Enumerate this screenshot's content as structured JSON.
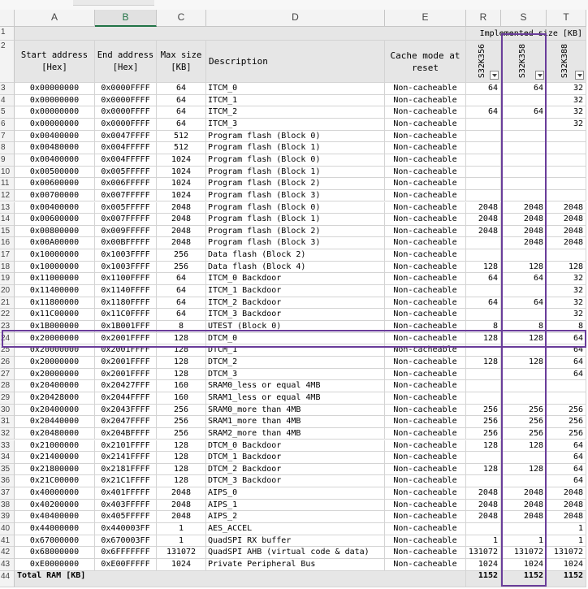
{
  "columns": [
    "A",
    "B",
    "C",
    "D",
    "E",
    "R",
    "S",
    "T"
  ],
  "selected_column": "B",
  "group_header": "Implemented size [KB]",
  "headers": {
    "start": "Start address [Hex]",
    "end": "End address [Hex]",
    "max": "Max size [KB]",
    "desc": "Description",
    "cache": "Cache mode at reset",
    "r": "S32K356",
    "s": "S32K358",
    "t": "S32K388"
  },
  "rows": [
    {
      "n": "3",
      "start": "0x00000000",
      "end": "0x0000FFFF",
      "max": "64",
      "desc": "ITCM_0",
      "cache": "Non-cacheable",
      "r": "64",
      "s": "64",
      "t": "32"
    },
    {
      "n": "4",
      "start": "0x00000000",
      "end": "0x0000FFFF",
      "max": "64",
      "desc": "ITCM_1",
      "cache": "Non-cacheable",
      "r": "",
      "s": "",
      "t": "32"
    },
    {
      "n": "5",
      "start": "0x00000000",
      "end": "0x0000FFFF",
      "max": "64",
      "desc": "ITCM_2",
      "cache": "Non-cacheable",
      "r": "64",
      "s": "64",
      "t": "32"
    },
    {
      "n": "6",
      "start": "0x00000000",
      "end": "0x0000FFFF",
      "max": "64",
      "desc": "ITCM_3",
      "cache": "Non-cacheable",
      "r": "",
      "s": "",
      "t": "32"
    },
    {
      "n": "7",
      "start": "0x00400000",
      "end": "0x0047FFFF",
      "max": "512",
      "desc": "Program flash (Block 0)",
      "cache": "Non-cacheable",
      "r": "",
      "s": "",
      "t": ""
    },
    {
      "n": "8",
      "start": "0x00480000",
      "end": "0x004FFFFF",
      "max": "512",
      "desc": "Program flash (Block 1)",
      "cache": "Non-cacheable",
      "r": "",
      "s": "",
      "t": ""
    },
    {
      "n": "9",
      "start": "0x00400000",
      "end": "0x004FFFFF",
      "max": "1024",
      "desc": "Program flash (Block 0)",
      "cache": "Non-cacheable",
      "r": "",
      "s": "",
      "t": ""
    },
    {
      "n": "10",
      "start": "0x00500000",
      "end": "0x005FFFFF",
      "max": "1024",
      "desc": "Program flash (Block 1)",
      "cache": "Non-cacheable",
      "r": "",
      "s": "",
      "t": ""
    },
    {
      "n": "11",
      "start": "0x00600000",
      "end": "0x006FFFFF",
      "max": "1024",
      "desc": "Program flash (Block 2)",
      "cache": "Non-cacheable",
      "r": "",
      "s": "",
      "t": ""
    },
    {
      "n": "12",
      "start": "0x00700000",
      "end": "0x007FFFFF",
      "max": "1024",
      "desc": "Program flash (Block 3)",
      "cache": "Non-cacheable",
      "r": "",
      "s": "",
      "t": ""
    },
    {
      "n": "13",
      "start": "0x00400000",
      "end": "0x005FFFFF",
      "max": "2048",
      "desc": "Program flash (Block 0)",
      "cache": "Non-cacheable",
      "r": "2048",
      "s": "2048",
      "t": "2048"
    },
    {
      "n": "14",
      "start": "0x00600000",
      "end": "0x007FFFFF",
      "max": "2048",
      "desc": "Program flash (Block 1)",
      "cache": "Non-cacheable",
      "r": "2048",
      "s": "2048",
      "t": "2048"
    },
    {
      "n": "15",
      "start": "0x00800000",
      "end": "0x009FFFFF",
      "max": "2048",
      "desc": "Program flash (Block 2)",
      "cache": "Non-cacheable",
      "r": "2048",
      "s": "2048",
      "t": "2048"
    },
    {
      "n": "16",
      "start": "0x00A00000",
      "end": "0x00BFFFFF",
      "max": "2048",
      "desc": "Program flash (Block 3)",
      "cache": "Non-cacheable",
      "r": "",
      "s": "2048",
      "t": "2048"
    },
    {
      "n": "17",
      "start": "0x10000000",
      "end": "0x1003FFFF",
      "max": "256",
      "desc": "Data flash (Block 2)",
      "cache": "Non-cacheable",
      "r": "",
      "s": "",
      "t": ""
    },
    {
      "n": "18",
      "start": "0x10000000",
      "end": "0x1003FFFF",
      "max": "256",
      "desc": "Data flash (Block 4)",
      "cache": "Non-cacheable",
      "r": "128",
      "s": "128",
      "t": "128"
    },
    {
      "n": "19",
      "start": "0x11000000",
      "end": "0x1100FFFF",
      "max": "64",
      "desc": "ITCM_0 Backdoor",
      "cache": "Non-cacheable",
      "r": "64",
      "s": "64",
      "t": "32"
    },
    {
      "n": "20",
      "start": "0x11400000",
      "end": "0x1140FFFF",
      "max": "64",
      "desc": "ITCM_1 Backdoor",
      "cache": "Non-cacheable",
      "r": "",
      "s": "",
      "t": "32"
    },
    {
      "n": "21",
      "start": "0x11800000",
      "end": "0x1180FFFF",
      "max": "64",
      "desc": "ITCM_2 Backdoor",
      "cache": "Non-cacheable",
      "r": "64",
      "s": "64",
      "t": "32"
    },
    {
      "n": "22",
      "start": "0x11C00000",
      "end": "0x11C0FFFF",
      "max": "64",
      "desc": "ITCM_3 Backdoor",
      "cache": "Non-cacheable",
      "r": "",
      "s": "",
      "t": "32"
    },
    {
      "n": "23",
      "start": "0x1B000000",
      "end": "0x1B001FFF",
      "max": "8",
      "desc": "UTEST (Block 0)",
      "cache": "Non-cacheable",
      "r": "8",
      "s": "8",
      "t": "8"
    },
    {
      "n": "24",
      "start": "0x20000000",
      "end": "0x2001FFFF",
      "max": "128",
      "desc": "DTCM_0",
      "cache": "Non-cacheable",
      "r": "128",
      "s": "128",
      "t": "64"
    },
    {
      "n": "25",
      "start": "0x20000000",
      "end": "0x2001FFFF",
      "max": "128",
      "desc": "DTCM_1",
      "cache": "Non-cacheable",
      "r": "",
      "s": "",
      "t": "64"
    },
    {
      "n": "26",
      "start": "0x20000000",
      "end": "0x2001FFFF",
      "max": "128",
      "desc": "DTCM_2",
      "cache": "Non-cacheable",
      "r": "128",
      "s": "128",
      "t": "64"
    },
    {
      "n": "27",
      "start": "0x20000000",
      "end": "0x2001FFFF",
      "max": "128",
      "desc": "DTCM_3",
      "cache": "Non-cacheable",
      "r": "",
      "s": "",
      "t": "64"
    },
    {
      "n": "28",
      "start": "0x20400000",
      "end": "0x20427FFF",
      "max": "160",
      "desc": "SRAM0_less or equal 4MB",
      "cache": "Non-cacheable",
      "r": "",
      "s": "",
      "t": ""
    },
    {
      "n": "29",
      "start": "0x20428000",
      "end": "0x2044FFFF",
      "max": "160",
      "desc": "SRAM1_less or equal 4MB",
      "cache": "Non-cacheable",
      "r": "",
      "s": "",
      "t": ""
    },
    {
      "n": "30",
      "start": "0x20400000",
      "end": "0x2043FFFF",
      "max": "256",
      "desc": "SRAM0_more than 4MB",
      "cache": "Non-cacheable",
      "r": "256",
      "s": "256",
      "t": "256"
    },
    {
      "n": "31",
      "start": "0x20440000",
      "end": "0x2047FFFF",
      "max": "256",
      "desc": "SRAM1_more than 4MB",
      "cache": "Non-cacheable",
      "r": "256",
      "s": "256",
      "t": "256"
    },
    {
      "n": "32",
      "start": "0x20480000",
      "end": "0x204BFFFF",
      "max": "256",
      "desc": "SRAM2_more than 4MB",
      "cache": "Non-cacheable",
      "r": "256",
      "s": "256",
      "t": "256"
    },
    {
      "n": "33",
      "start": "0x21000000",
      "end": "0x2101FFFF",
      "max": "128",
      "desc": "DTCM_0 Backdoor",
      "cache": "Non-cacheable",
      "r": "128",
      "s": "128",
      "t": "64"
    },
    {
      "n": "34",
      "start": "0x21400000",
      "end": "0x2141FFFF",
      "max": "128",
      "desc": "DTCM_1 Backdoor",
      "cache": "Non-cacheable",
      "r": "",
      "s": "",
      "t": "64"
    },
    {
      "n": "35",
      "start": "0x21800000",
      "end": "0x2181FFFF",
      "max": "128",
      "desc": "DTCM_2 Backdoor",
      "cache": "Non-cacheable",
      "r": "128",
      "s": "128",
      "t": "64"
    },
    {
      "n": "36",
      "start": "0x21C00000",
      "end": "0x21C1FFFF",
      "max": "128",
      "desc": "DTCM_3 Backdoor",
      "cache": "Non-cacheable",
      "r": "",
      "s": "",
      "t": "64"
    },
    {
      "n": "37",
      "start": "0x40000000",
      "end": "0x401FFFFF",
      "max": "2048",
      "desc": "AIPS_0",
      "cache": "Non-cacheable",
      "r": "2048",
      "s": "2048",
      "t": "2048"
    },
    {
      "n": "38",
      "start": "0x40200000",
      "end": "0x403FFFFF",
      "max": "2048",
      "desc": "AIPS_1",
      "cache": "Non-cacheable",
      "r": "2048",
      "s": "2048",
      "t": "2048"
    },
    {
      "n": "39",
      "start": "0x40400000",
      "end": "0x405FFFFF",
      "max": "2048",
      "desc": "AIPS_2",
      "cache": "Non-cacheable",
      "r": "2048",
      "s": "2048",
      "t": "2048"
    },
    {
      "n": "40",
      "start": "0x44000000",
      "end": "0x440003FF",
      "max": "1",
      "desc": "AES_ACCEL",
      "cache": "Non-cacheable",
      "r": "",
      "s": "",
      "t": "1"
    },
    {
      "n": "41",
      "start": "0x67000000",
      "end": "0x670003FF",
      "max": "1",
      "desc": "QuadSPI RX buffer",
      "cache": "Non-cacheable",
      "r": "1",
      "s": "1",
      "t": "1"
    },
    {
      "n": "42",
      "start": "0x68000000",
      "end": "0x6FFFFFFF",
      "max": "131072",
      "desc": "QuadSPI AHB (virtual code & data)",
      "cache": "Non-cacheable",
      "r": "131072",
      "s": "131072",
      "t": "131072"
    },
    {
      "n": "43",
      "start": "0xE0000000",
      "end": "0xE00FFFFF",
      "max": "1024",
      "desc": "Private Peripheral Bus",
      "cache": "Non-cacheable",
      "r": "1024",
      "s": "1024",
      "t": "1024"
    }
  ],
  "total": {
    "n": "44",
    "label": "Total RAM [KB]",
    "r": "1152",
    "s": "1152",
    "t": "1152"
  },
  "highlight_color": "#6a3d9a"
}
